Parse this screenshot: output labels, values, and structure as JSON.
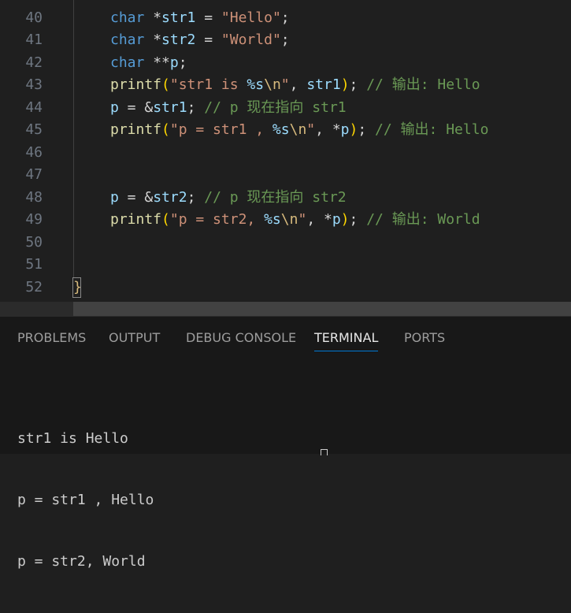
{
  "editor": {
    "lines": [
      {
        "num": "40",
        "segments": [
          {
            "t": "char",
            "c": "kw"
          },
          {
            "t": " *",
            "c": "op"
          },
          {
            "t": "str1",
            "c": "var"
          },
          {
            "t": " = ",
            "c": "op"
          },
          {
            "t": "\"Hello\"",
            "c": "str"
          },
          {
            "t": ";",
            "c": "op"
          }
        ]
      },
      {
        "num": "41",
        "segments": [
          {
            "t": "char",
            "c": "kw"
          },
          {
            "t": " *",
            "c": "op"
          },
          {
            "t": "str2",
            "c": "var"
          },
          {
            "t": " = ",
            "c": "op"
          },
          {
            "t": "\"World\"",
            "c": "str"
          },
          {
            "t": ";",
            "c": "op"
          }
        ]
      },
      {
        "num": "42",
        "segments": [
          {
            "t": "char",
            "c": "kw"
          },
          {
            "t": " **",
            "c": "op"
          },
          {
            "t": "p",
            "c": "var"
          },
          {
            "t": ";",
            "c": "op"
          }
        ]
      },
      {
        "num": "43",
        "segments": [
          {
            "t": "printf",
            "c": "fn"
          },
          {
            "t": "(",
            "c": "p1"
          },
          {
            "t": "\"str1 is ",
            "c": "str"
          },
          {
            "t": "%s",
            "c": "fmt"
          },
          {
            "t": "\\n",
            "c": "esc"
          },
          {
            "t": "\"",
            "c": "str"
          },
          {
            "t": ", ",
            "c": "op"
          },
          {
            "t": "str1",
            "c": "var"
          },
          {
            "t": ")",
            "c": "p1"
          },
          {
            "t": "; ",
            "c": "op"
          },
          {
            "t": "// 输出: Hello",
            "c": "cm"
          }
        ]
      },
      {
        "num": "44",
        "segments": [
          {
            "t": "p",
            "c": "var"
          },
          {
            "t": " = &",
            "c": "op"
          },
          {
            "t": "str1",
            "c": "var"
          },
          {
            "t": "; ",
            "c": "op"
          },
          {
            "t": "// p 现在指向 str1",
            "c": "cm"
          }
        ]
      },
      {
        "num": "45",
        "segments": [
          {
            "t": "printf",
            "c": "fn"
          },
          {
            "t": "(",
            "c": "p1"
          },
          {
            "t": "\"p = str1 , ",
            "c": "str"
          },
          {
            "t": "%s",
            "c": "fmt"
          },
          {
            "t": "\\n",
            "c": "esc"
          },
          {
            "t": "\"",
            "c": "str"
          },
          {
            "t": ", *",
            "c": "op"
          },
          {
            "t": "p",
            "c": "var"
          },
          {
            "t": ")",
            "c": "p1"
          },
          {
            "t": "; ",
            "c": "op"
          },
          {
            "t": "// 输出: Hello",
            "c": "cm"
          }
        ]
      },
      {
        "num": "46",
        "segments": []
      },
      {
        "num": "47",
        "segments": []
      },
      {
        "num": "48",
        "segments": [
          {
            "t": "p",
            "c": "var"
          },
          {
            "t": " = &",
            "c": "op"
          },
          {
            "t": "str2",
            "c": "var"
          },
          {
            "t": "; ",
            "c": "op"
          },
          {
            "t": "// p 现在指向 str2",
            "c": "cm"
          }
        ]
      },
      {
        "num": "49",
        "segments": [
          {
            "t": "printf",
            "c": "fn"
          },
          {
            "t": "(",
            "c": "p1"
          },
          {
            "t": "\"p = str2, ",
            "c": "str"
          },
          {
            "t": "%s",
            "c": "fmt"
          },
          {
            "t": "\\n",
            "c": "esc"
          },
          {
            "t": "\"",
            "c": "str"
          },
          {
            "t": ", *",
            "c": "op"
          },
          {
            "t": "p",
            "c": "var"
          },
          {
            "t": ")",
            "c": "p1"
          },
          {
            "t": "; ",
            "c": "op"
          },
          {
            "t": "// 输出: World",
            "c": "cm"
          }
        ]
      },
      {
        "num": "50",
        "segments": []
      },
      {
        "num": "51",
        "segments": []
      }
    ],
    "closing_line_number": "52",
    "closing_brace": "}"
  },
  "panel": {
    "tabs": [
      {
        "label": "PROBLEMS",
        "active": false
      },
      {
        "label": "OUTPUT",
        "active": false
      },
      {
        "label": "DEBUG CONSOLE",
        "active": false
      },
      {
        "label": "TERMINAL",
        "active": true
      },
      {
        "label": "PORTS",
        "active": false
      }
    ],
    "terminal_lines": [
      "str1 is Hello",
      "p = str1 , Hello",
      "p = str2, World"
    ]
  },
  "colors": {
    "keyword": "#569cd6",
    "variable": "#9cdcfe",
    "string": "#ce9178",
    "function": "#dcdcaa",
    "comment": "#6a9955",
    "active_tab_underline": "#0078d4"
  }
}
